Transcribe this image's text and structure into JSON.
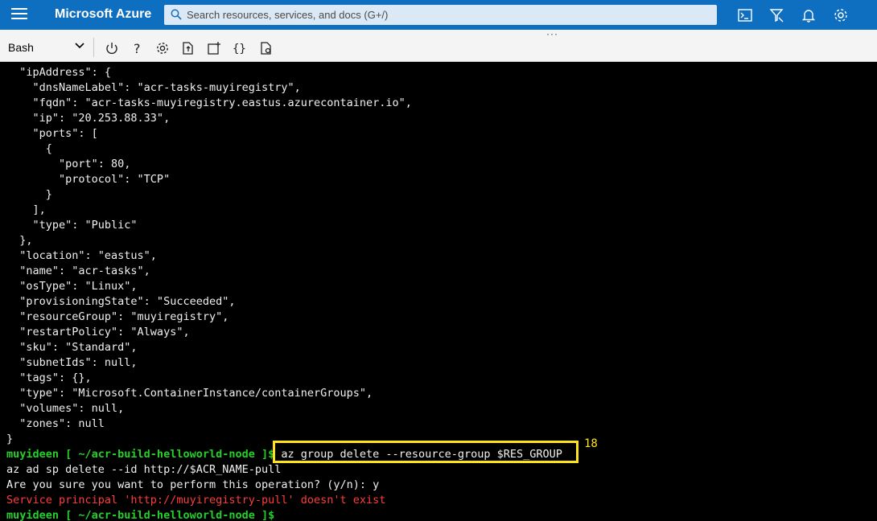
{
  "topbar": {
    "brand": "Microsoft Azure",
    "search_placeholder": "Search resources, services, and docs (G+/)",
    "accent": "#0e6ec0"
  },
  "toolbar": {
    "shell_selected": "Bash",
    "icons": [
      "power-icon",
      "help-icon",
      "settings-icon",
      "upload-download-icon",
      "new-session-icon",
      "editor-braces-icon",
      "web-preview-icon"
    ]
  },
  "terminal": {
    "lines": [
      "  \"ipAddress\": {",
      "    \"dnsNameLabel\": \"acr-tasks-muyiregistry\",",
      "    \"fqdn\": \"acr-tasks-muyiregistry.eastus.azurecontainer.io\",",
      "    \"ip\": \"20.253.88.33\",",
      "    \"ports\": [",
      "      {",
      "        \"port\": 80,",
      "        \"protocol\": \"TCP\"",
      "      }",
      "    ],",
      "    \"type\": \"Public\"",
      "  },",
      "  \"location\": \"eastus\",",
      "  \"name\": \"acr-tasks\",",
      "  \"osType\": \"Linux\",",
      "  \"provisioningState\": \"Succeeded\",",
      "  \"resourceGroup\": \"muyiregistry\",",
      "  \"restartPolicy\": \"Always\",",
      "  \"sku\": \"Standard\",",
      "  \"subnetIds\": null,",
      "  \"tags\": {},",
      "  \"type\": \"Microsoft.ContainerInstance/containerGroups\",",
      "  \"volumes\": null,",
      "  \"zones\": null",
      "}"
    ],
    "prompt": "muyideen [ ~/acr-build-helloworld-node ]$",
    "command1": " az group delete --resource-group $RES_GROUP",
    "line2": "az ad sp delete --id http://$ACR_NAME-pull",
    "line3": "Are you sure you want to perform this operation? (y/n): y",
    "error": "Service principal 'http://muyiregistry-pull' doesn't exist",
    "prompt2": "muyideen [ ~/acr-build-helloworld-node ]$",
    "annotation_number": "18"
  }
}
